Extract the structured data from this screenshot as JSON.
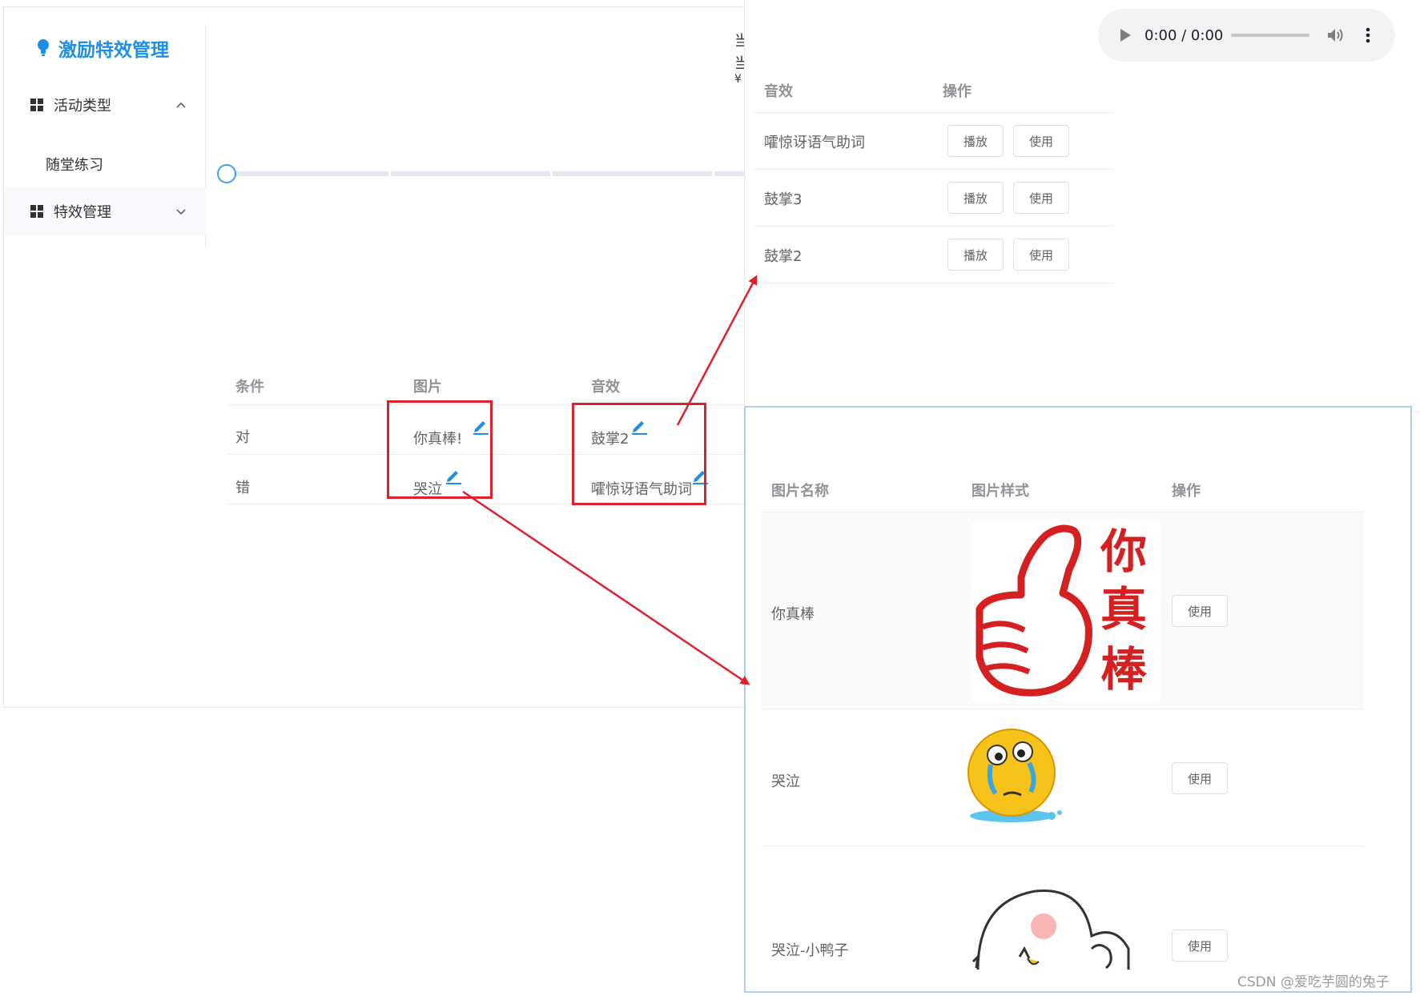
{
  "app": {
    "title": "激励特效管理",
    "accent_color": "#1e8fe6"
  },
  "sidebar": {
    "items": [
      {
        "label": "活动类型",
        "icon": "grid-icon",
        "chevron": "chevron-up-icon"
      },
      {
        "label": "随堂练习"
      },
      {
        "label": "特效管理",
        "icon": "grid-icon",
        "chevron": "chevron-down-icon"
      }
    ]
  },
  "cut_text": [
    "当",
    "当",
    "¥"
  ],
  "effects_table": {
    "headers": [
      "条件",
      "图片",
      "音效"
    ],
    "rows": [
      {
        "condition": "对",
        "image": "你真棒!",
        "sound": "鼓掌2"
      },
      {
        "condition": "错",
        "image": "哭泣",
        "sound": "嚯惊讶语气助词"
      }
    ]
  },
  "audio_popup": {
    "time": "0:00 / 0:00",
    "headers": [
      "音效",
      "操作"
    ],
    "rows": [
      {
        "name": "嚯惊讶语气助词",
        "play": "播放",
        "use": "使用"
      },
      {
        "name": "鼓掌3",
        "play": "播放",
        "use": "使用"
      },
      {
        "name": "鼓掌2",
        "play": "播放",
        "use": "使用"
      }
    ]
  },
  "image_popup": {
    "headers": [
      "图片名称",
      "图片样式",
      "操作"
    ],
    "rows": [
      {
        "name": "你真棒",
        "use": "使用",
        "stamp_text": [
          "你",
          "真",
          "棒"
        ]
      },
      {
        "name": "哭泣",
        "use": "使用"
      },
      {
        "name": "哭泣-小鸭子",
        "use": "使用"
      }
    ]
  },
  "watermark": "CSDN @爱吃芋圆的兔子",
  "colors": {
    "highlight_red": "#e0202a",
    "link_blue": "#1e8fe6",
    "stamp_red": "#d42020"
  }
}
